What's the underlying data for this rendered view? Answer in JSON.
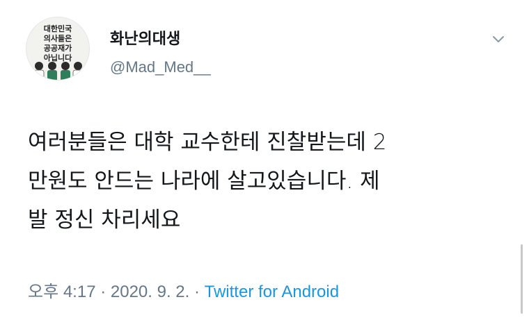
{
  "author": {
    "display_name": "화난의대생",
    "handle": "@Mad_Med__",
    "avatar_text": [
      "대한민국",
      "의사들은",
      "공공재가",
      "아닙니다"
    ]
  },
  "tweet": {
    "lines": [
      "여러분들은 대학 교수한테 진찰받는데 2",
      "만원도 안드는 나라에 살고있습니다. 제",
      "발 정신 차리세요"
    ]
  },
  "meta": {
    "time": "오후 4:17",
    "separator": " · ",
    "date": "2020. 9. 2.",
    "source": "Twitter for Android"
  },
  "icons": {
    "menu_caret": "chevron-down-icon"
  },
  "colors": {
    "text": "#14171a",
    "secondary": "#657786",
    "link": "#1b95e0"
  }
}
